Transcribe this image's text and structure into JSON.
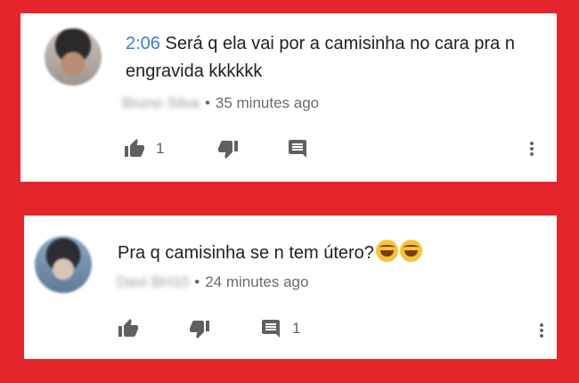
{
  "comments": [
    {
      "timestamp_link": "2:06",
      "text": " Será q ela vai por a camisinha no cara pra n engravida kkkkkk",
      "author": "Bruno Silva",
      "time_ago": "35 minutes ago",
      "like_count": "1",
      "reply_count": "",
      "icons": {
        "like": "thumb-up-icon",
        "dislike": "thumb-down-icon",
        "reply": "comment-icon",
        "menu": "more-vert-icon"
      }
    },
    {
      "text": "Pra q camisinha se n tem útero?",
      "emoji": [
        "face-with-tears-of-joy",
        "face-with-tears-of-joy"
      ],
      "author": "Davi BH10",
      "time_ago": "24 minutes ago",
      "like_count": "",
      "reply_count": "1",
      "icons": {
        "like": "thumb-up-icon",
        "dislike": "thumb-down-icon",
        "reply": "comment-icon",
        "menu": "more-vert-icon"
      }
    }
  ],
  "colors": {
    "background": "#e4262c",
    "card": "#ffffff",
    "timestamp_link": "#3a7be0",
    "text": "#212121",
    "meta": "#6b6b6b",
    "icon": "#606060"
  }
}
